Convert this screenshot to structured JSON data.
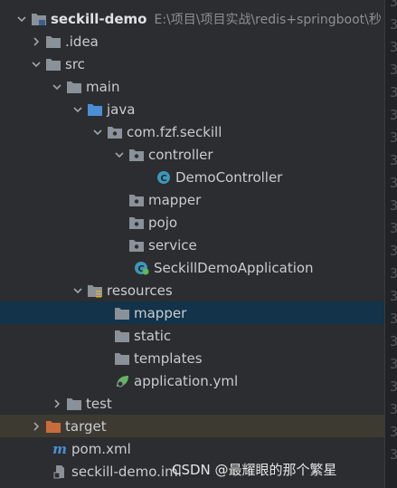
{
  "project": {
    "name": "seckill-demo",
    "path": "E:\\项目\\项目实战\\redis+springboot\\秒"
  },
  "tree": {
    "idea": ".idea",
    "src": "src",
    "main": "main",
    "java": "java",
    "package": "com.fzf.seckill",
    "controller": "controller",
    "demo_controller": "DemoController",
    "mapper": "mapper",
    "pojo": "pojo",
    "service": "service",
    "app_class": "SeckillDemoApplication",
    "resources": "resources",
    "res_mapper": "mapper",
    "static": "static",
    "templates": "templates",
    "app_yml": "application.yml",
    "test": "test",
    "target": "target",
    "pom": "pom.xml",
    "iml": "seckill-demo.iml"
  },
  "gutter_digits": [
    "3",
    "3",
    "3",
    "3",
    "3",
    "3",
    "3",
    "3",
    "3",
    "3",
    "3",
    "3",
    "3",
    "3",
    "3",
    "3",
    "3",
    "3",
    "3",
    "3",
    "3"
  ],
  "watermark": "CSDN @最耀眼的那个繁星",
  "colors": {
    "background": "#2b2d30",
    "selection": "#12334a",
    "excluded_row": "#3d3a32",
    "folder": "#8a9199",
    "source_folder": "#4a8fd6",
    "excluded_folder": "#c96c3c",
    "class_icon": "#3d97b8",
    "spring_green": "#5fb760",
    "maven_blue": "#4a8fd6"
  }
}
